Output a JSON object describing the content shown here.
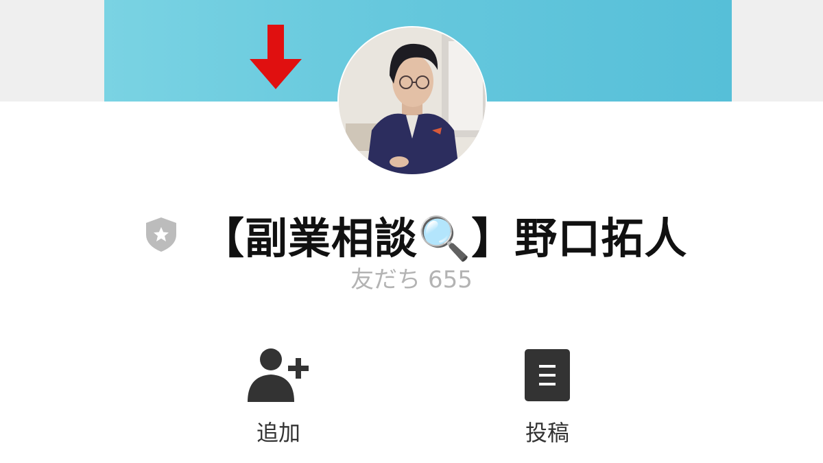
{
  "profile": {
    "name": "【副業相談🔍】野口拓人",
    "friends_label": "友だち 655",
    "badge_icon": "verified-shield-star-icon",
    "avatar_icon": "profile-photo"
  },
  "cover": {
    "arrow_icon": "down-arrow-icon",
    "arrow_color": "#e01010",
    "background_color": "#66c8dd"
  },
  "actions": [
    {
      "label": "追加",
      "icon": "add-friend-icon"
    },
    {
      "label": "投稿",
      "icon": "posts-document-icon"
    }
  ],
  "colors": {
    "icon_dark": "#333333",
    "friends_text": "#b3b3b3",
    "badge": "#bcbcbc"
  }
}
